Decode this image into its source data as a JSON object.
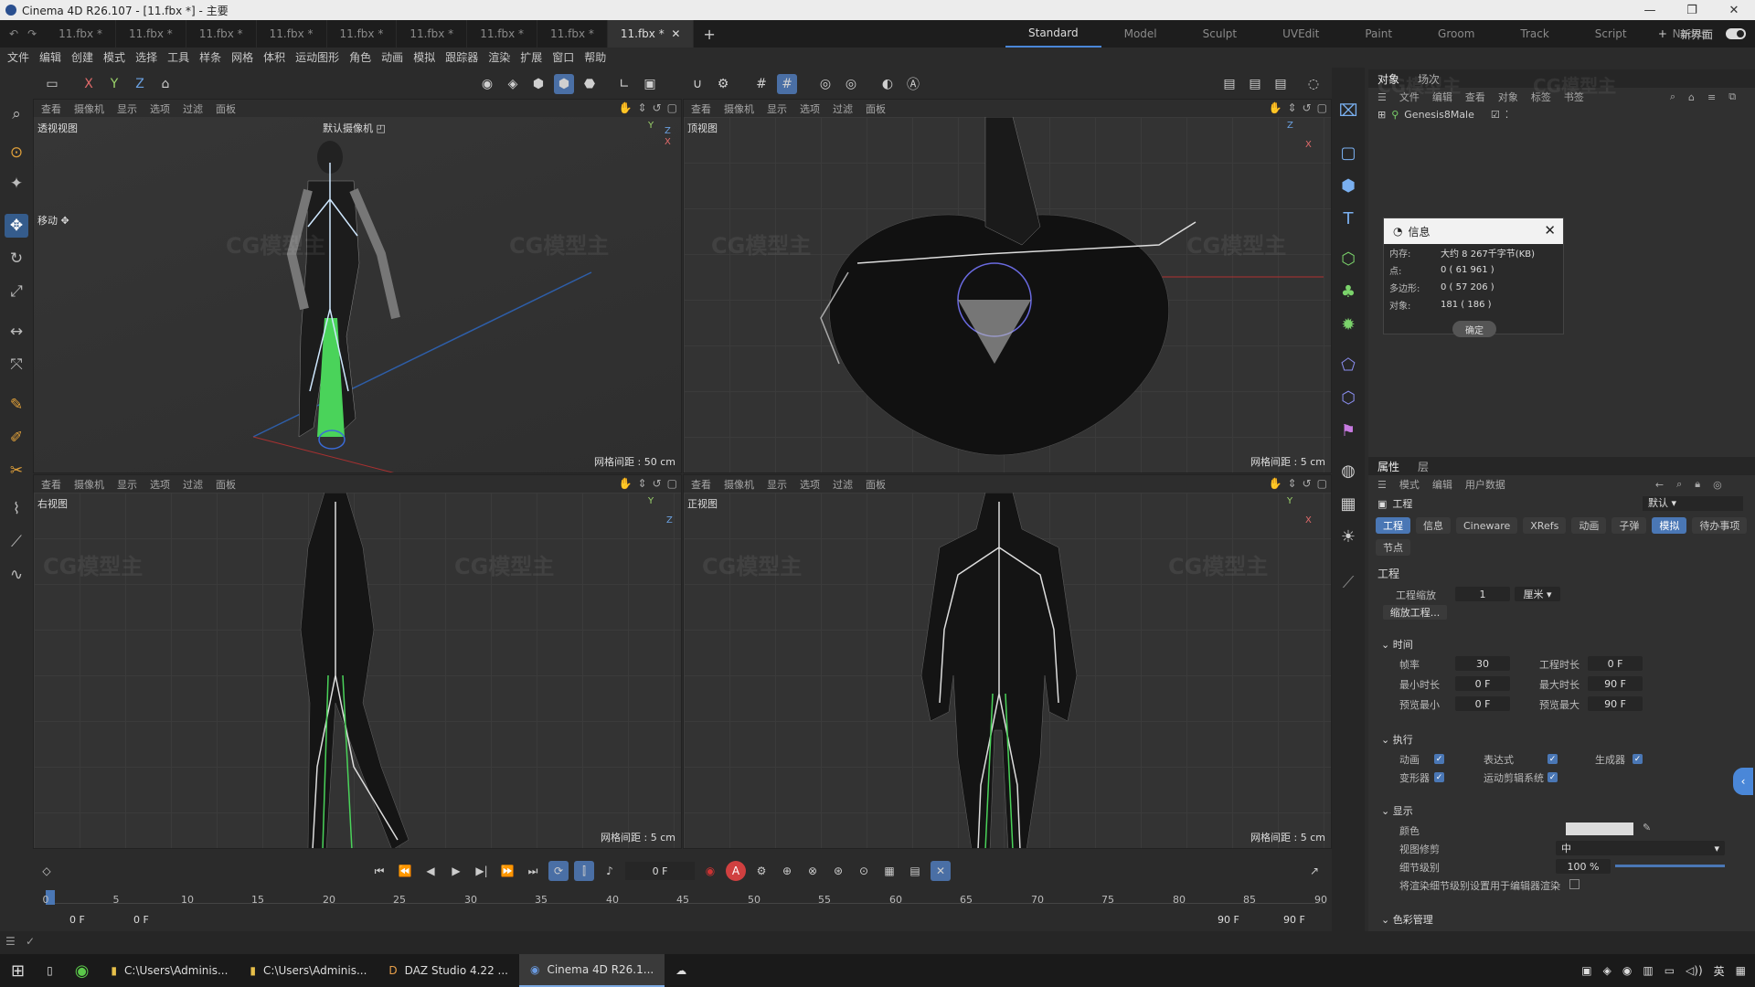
{
  "window": {
    "title": "Cinema 4D R26.107 - [11.fbx *] - 主要"
  },
  "doc_tabs": [
    "11.fbx *",
    "11.fbx *",
    "11.fbx *",
    "11.fbx *",
    "11.fbx *",
    "11.fbx *",
    "11.fbx *",
    "11.fbx *",
    "11.fbx *"
  ],
  "layouts": [
    "Standard",
    "Model",
    "Sculpt",
    "UVEdit",
    "Paint",
    "Groom",
    "Track",
    "Script",
    "Nodes"
  ],
  "new_ui_label": "新界面",
  "menu": [
    "文件",
    "编辑",
    "创建",
    "模式",
    "选择",
    "工具",
    "样条",
    "网格",
    "体积",
    "运动图形",
    "角色",
    "动画",
    "模拟",
    "跟踪器",
    "渲染",
    "扩展",
    "窗口",
    "帮助"
  ],
  "axes": {
    "x": "X",
    "y": "Y",
    "z": "Z"
  },
  "viewport_menu": [
    "查看",
    "摄像机",
    "显示",
    "选项",
    "过滤",
    "面板"
  ],
  "viewports": {
    "persp": {
      "name": "透视视图",
      "camera": "默认摄像机",
      "grid": "网格间距 : 50 cm",
      "move_label": "移动"
    },
    "top": {
      "name": "顶视图",
      "grid": "网格间距 : 5 cm"
    },
    "right": {
      "name": "右视图",
      "grid": "网格间距 : 5 cm"
    },
    "front": {
      "name": "正视图",
      "grid": "网格间距 : 5 cm"
    }
  },
  "watermark": "CG模型主",
  "objects_panel": {
    "tabs": [
      "对象",
      "场次"
    ],
    "menu": [
      "文件",
      "编辑",
      "查看",
      "对象",
      "标签",
      "书签"
    ],
    "object": "Genesis8Male"
  },
  "info_dialog": {
    "title": "信息",
    "rows": [
      {
        "k": "内存:",
        "v": "大约 8 267千字节(KB)"
      },
      {
        "k": "点:",
        "v": "0 ( 61 961 )"
      },
      {
        "k": "多边形:",
        "v": "0 ( 57 206 )"
      },
      {
        "k": "对象:",
        "v": "181 ( 186 )"
      }
    ],
    "ok": "确定"
  },
  "attr_panel": {
    "tabs": [
      "属性",
      "层"
    ],
    "menu": [
      "模式",
      "编辑",
      "用户数据"
    ],
    "header": "工程",
    "preset": "默认",
    "chips": [
      "工程",
      "信息",
      "Cineware",
      "XRefs",
      "动画",
      "子弹",
      "模拟",
      "待办事项",
      "节点"
    ],
    "section_project": "工程",
    "scale_label": "工程缩放",
    "scale_value": "1",
    "scale_unit": "厘米",
    "scale_button": "缩放工程...",
    "time_label": "时间",
    "fps_label": "帧率",
    "fps": "30",
    "duration_label": "工程时长",
    "duration": "0 F",
    "min_label": "最小时长",
    "min": "0 F",
    "max_label": "最大时长",
    "max": "90 F",
    "pmin_label": "预览最小",
    "pmin": "0 F",
    "pmax_label": "预览最大",
    "pmax": "90 F",
    "exec_label": "执行",
    "anim": "动画",
    "expr": "表达式",
    "gen": "生成器",
    "deform": "变形器",
    "motion": "运动剪辑系统",
    "display_label": "显示",
    "color": "颜色",
    "clip": "视图修剪",
    "clip_value": "中",
    "lod": "细节级别",
    "lod_value": "100 %",
    "render_lod": "将渲染细节级别设置用于编辑器渲染",
    "color_mgmt": "色彩管理"
  },
  "timeline": {
    "frame": "0 F",
    "ticks": [
      "0",
      "5",
      "10",
      "15",
      "20",
      "25",
      "30",
      "35",
      "40",
      "45",
      "50",
      "55",
      "60",
      "65",
      "70",
      "75",
      "80",
      "85",
      "90"
    ],
    "start": "0 F",
    "start2": "0 F",
    "end": "90 F",
    "end2": "90 F"
  },
  "taskbar": [
    {
      "label": "C:\\Users\\Adminis..."
    },
    {
      "label": "C:\\Users\\Adminis..."
    },
    {
      "label": "DAZ Studio 4.22 ..."
    },
    {
      "label": "Cinema 4D R26.1..."
    }
  ],
  "tray": {
    "lang": "英"
  }
}
